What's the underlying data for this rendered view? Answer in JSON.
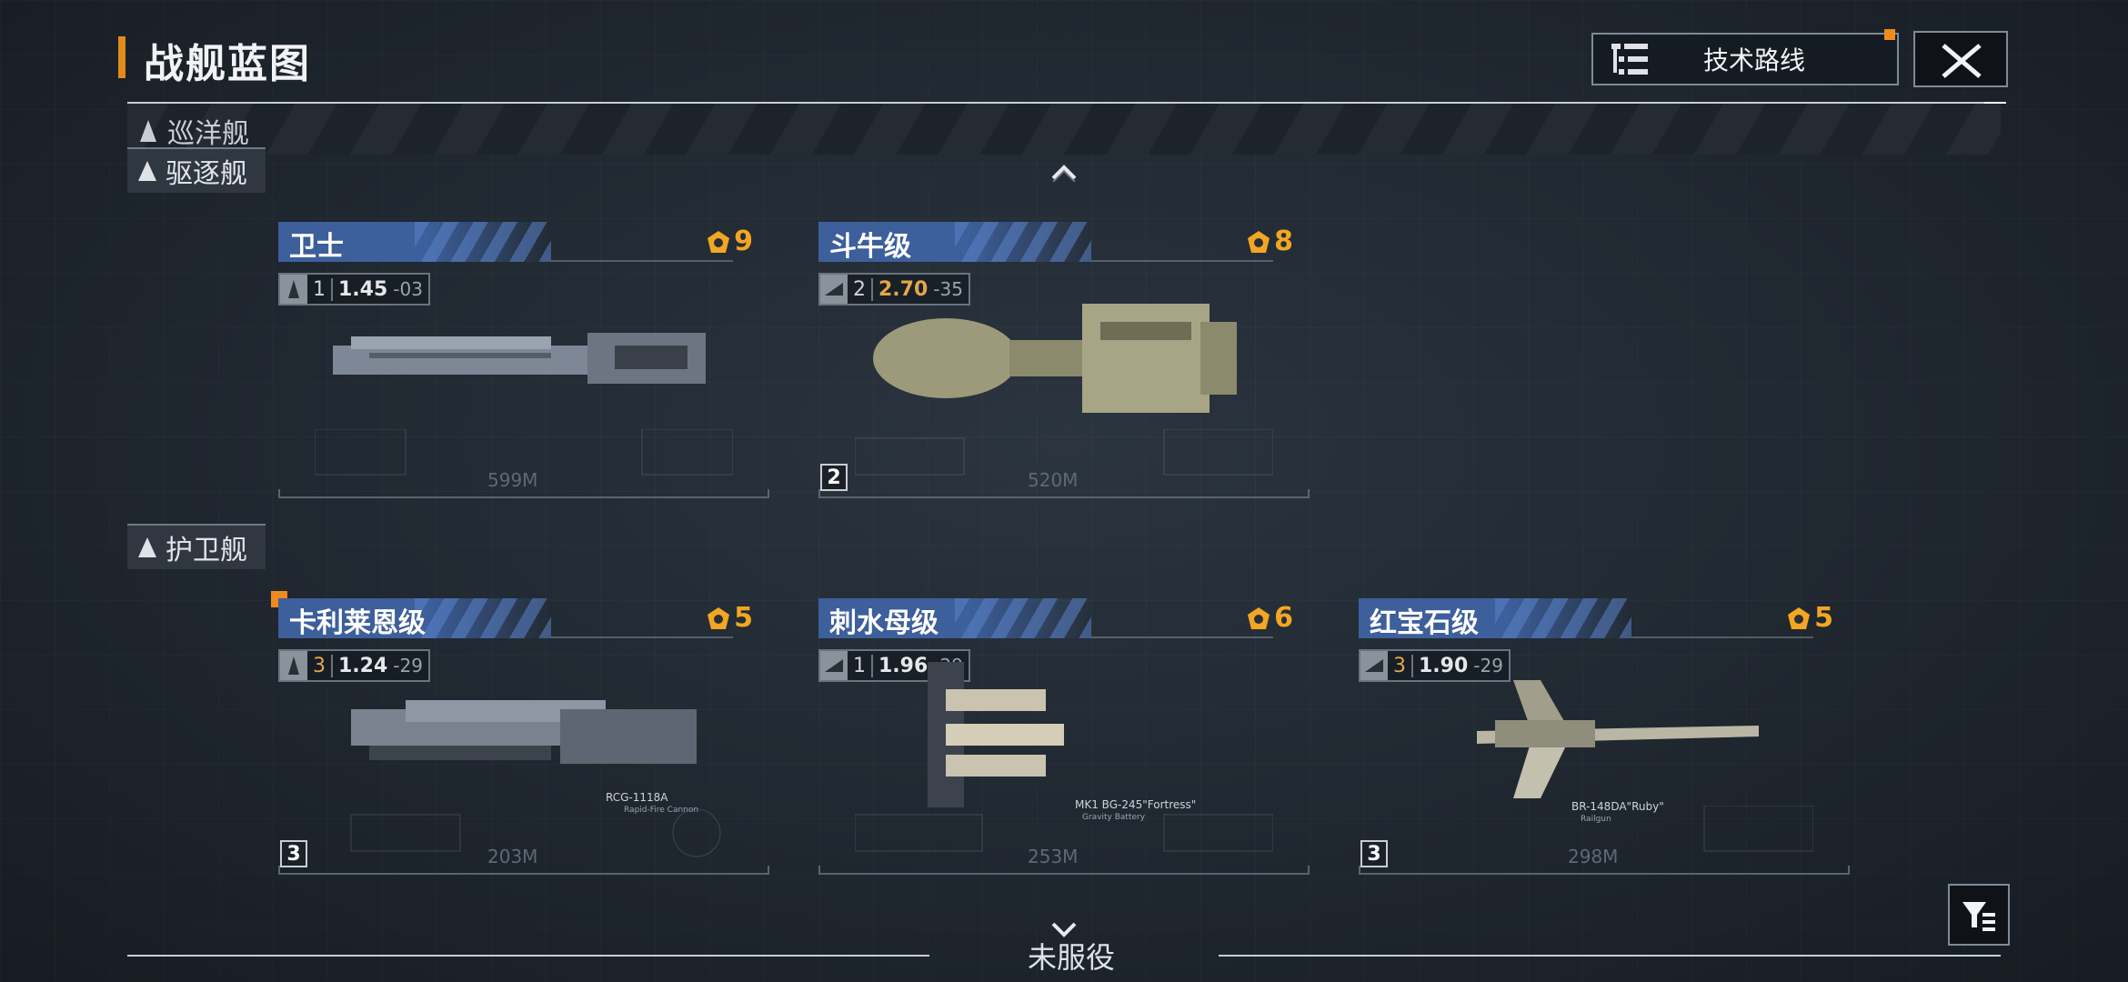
{
  "header": {
    "title": "战舰蓝图",
    "tech_route_label": "技术路线"
  },
  "categories": {
    "cruiser": "巡洋舰",
    "destroyer": "驱逐舰",
    "frigate": "护卫舰"
  },
  "ships": [
    {
      "name": "卫士",
      "cost": "9",
      "tier": "1",
      "speed": "1.45",
      "accel": "-03",
      "length": "599M",
      "count": ""
    },
    {
      "name": "斗牛级",
      "cost": "8",
      "tier": "2",
      "speed": "2.70",
      "accel": "-35",
      "length": "520M",
      "count": "2"
    },
    {
      "name": "卡利莱恩级",
      "cost": "5",
      "tier": "3",
      "speed": "1.24",
      "accel": "-29",
      "length": "203M",
      "count": "3",
      "weapon": "RCG-1118A",
      "weapon_sub": "Rapid-Fire Cannon"
    },
    {
      "name": "刺水母级",
      "cost": "6",
      "tier": "1",
      "speed": "1.96",
      "accel": "-29",
      "length": "253M",
      "count": "",
      "weapon": "MK1 BG-245\"Fortress\"",
      "weapon_sub": "Gravity Battery"
    },
    {
      "name": "红宝石级",
      "cost": "5",
      "tier": "3",
      "speed": "1.90",
      "accel": "-29",
      "length": "298M",
      "count": "3",
      "weapon": "BR-148DA\"Ruby\"",
      "weapon_sub": "Railgun"
    }
  ],
  "footer": {
    "inactive_label": "未服役"
  },
  "colors": {
    "accent_orange": "#f08a1c",
    "cost_gold": "#f2a623",
    "name_blue": "#3d5f9b"
  }
}
